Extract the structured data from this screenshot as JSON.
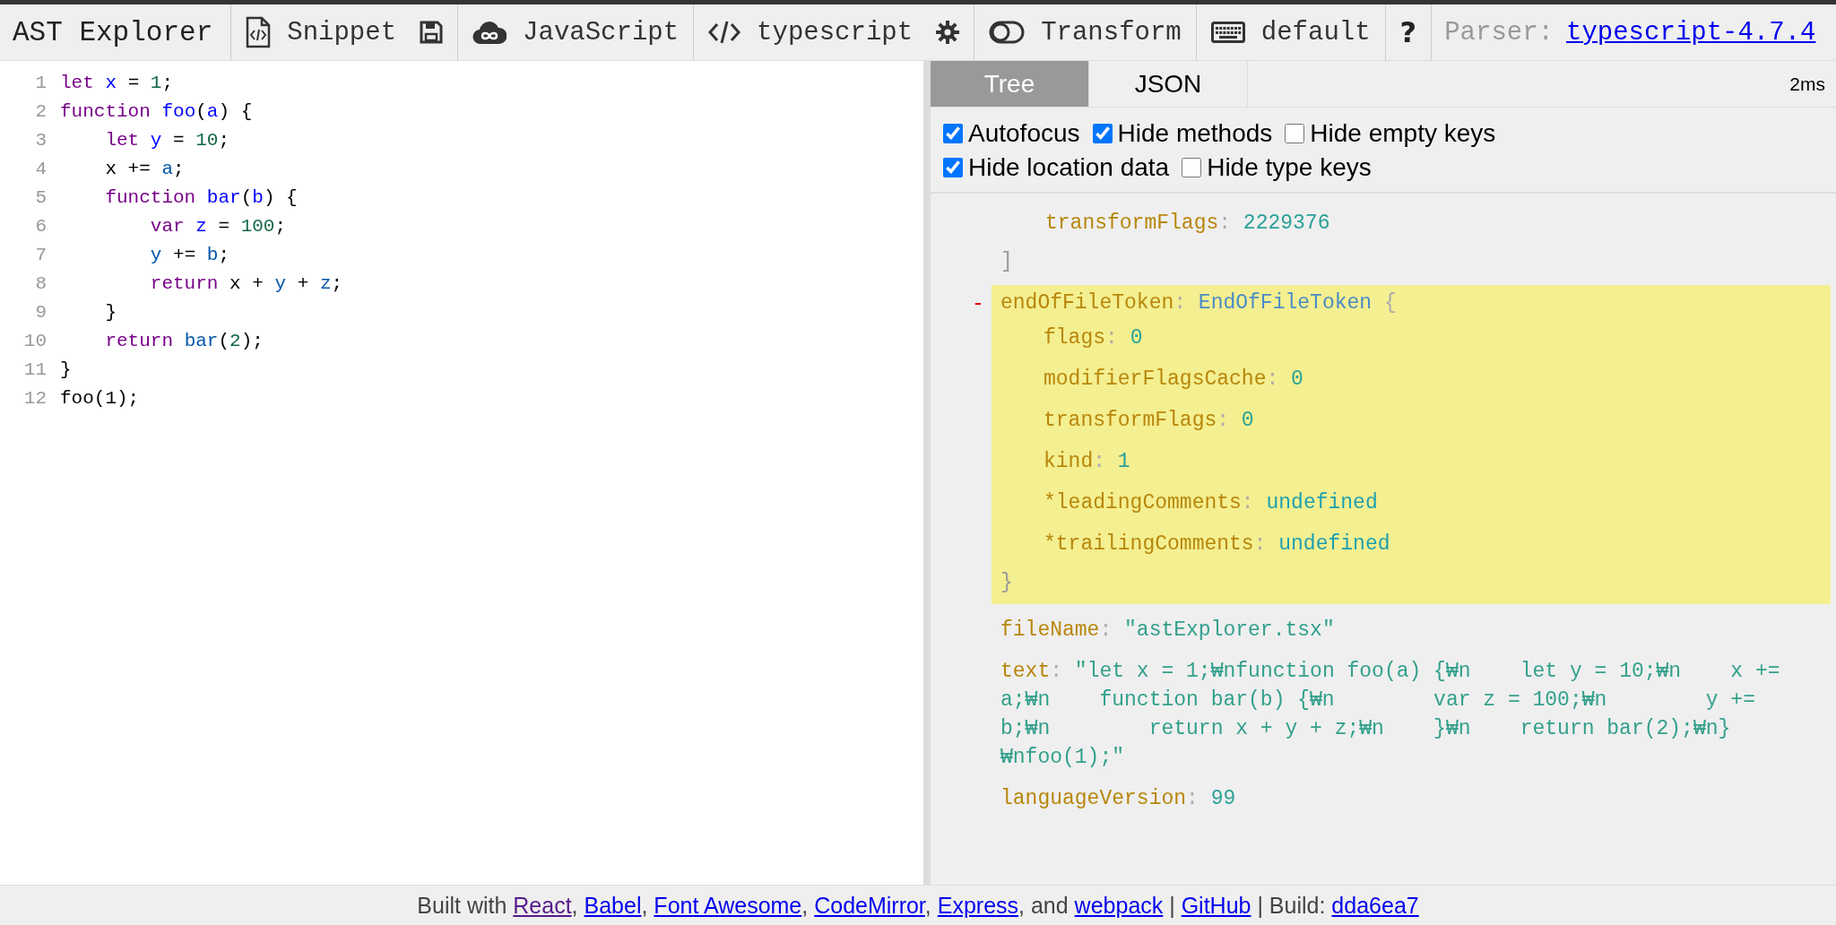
{
  "toolbar": {
    "title": "AST Explorer",
    "snippet": {
      "label": "Snippet"
    },
    "category": {
      "label": "JavaScript"
    },
    "parser": {
      "label": "typescript"
    },
    "transform": {
      "label": "Transform",
      "on": false
    },
    "keymap": {
      "label": "default"
    },
    "help": {
      "label": "?"
    },
    "parser_info": {
      "label": "Parser:",
      "link": "typescript-4.7.4"
    }
  },
  "editor": {
    "lines": [
      {
        "number": "1",
        "tokens": [
          {
            "t": "let",
            "kind": "keyword"
          },
          {
            "t": " x",
            "kind": "def"
          },
          {
            "t": " = ",
            "kind": "plain"
          },
          {
            "t": "1",
            "kind": "number"
          },
          {
            "t": ";",
            "kind": "plain"
          }
        ]
      },
      {
        "number": "2",
        "tokens": [
          {
            "t": "function",
            "kind": "keyword"
          },
          {
            "t": " foo",
            "kind": "def"
          },
          {
            "t": "(",
            "kind": "plain"
          },
          {
            "t": "a",
            "kind": "def"
          },
          {
            "t": ") {",
            "kind": "plain"
          }
        ]
      },
      {
        "number": "3",
        "tokens": [
          {
            "t": "    let",
            "kind": "keyword"
          },
          {
            "t": " y",
            "kind": "def"
          },
          {
            "t": " = ",
            "kind": "plain"
          },
          {
            "t": "10",
            "kind": "number"
          },
          {
            "t": ";",
            "kind": "plain"
          }
        ]
      },
      {
        "number": "4",
        "tokens": [
          {
            "t": "    x += ",
            "kind": "plain"
          },
          {
            "t": "a",
            "kind": "variable"
          },
          {
            "t": ";",
            "kind": "plain"
          }
        ]
      },
      {
        "number": "5",
        "tokens": [
          {
            "t": "    function",
            "kind": "keyword"
          },
          {
            "t": " bar",
            "kind": "def"
          },
          {
            "t": "(",
            "kind": "plain"
          },
          {
            "t": "b",
            "kind": "def"
          },
          {
            "t": ") {",
            "kind": "plain"
          }
        ]
      },
      {
        "number": "6",
        "tokens": [
          {
            "t": "        var",
            "kind": "keyword"
          },
          {
            "t": " z",
            "kind": "def"
          },
          {
            "t": " = ",
            "kind": "plain"
          },
          {
            "t": "100",
            "kind": "number"
          },
          {
            "t": ";",
            "kind": "plain"
          }
        ]
      },
      {
        "number": "7",
        "tokens": [
          {
            "t": "        y",
            "kind": "variable"
          },
          {
            "t": " += ",
            "kind": "plain"
          },
          {
            "t": "b",
            "kind": "variable"
          },
          {
            "t": ";",
            "kind": "plain"
          }
        ]
      },
      {
        "number": "8",
        "tokens": [
          {
            "t": "        return",
            "kind": "keyword"
          },
          {
            "t": " x + ",
            "kind": "plain"
          },
          {
            "t": "y",
            "kind": "variable"
          },
          {
            "t": " + ",
            "kind": "plain"
          },
          {
            "t": "z",
            "kind": "variable"
          },
          {
            "t": ";",
            "kind": "plain"
          }
        ]
      },
      {
        "number": "9",
        "tokens": [
          {
            "t": "    }",
            "kind": "plain"
          }
        ]
      },
      {
        "number": "10",
        "tokens": [
          {
            "t": "    return",
            "kind": "keyword"
          },
          {
            "t": " bar",
            "kind": "variable"
          },
          {
            "t": "(",
            "kind": "plain"
          },
          {
            "t": "2",
            "kind": "number"
          },
          {
            "t": ");",
            "kind": "plain"
          }
        ]
      },
      {
        "number": "11",
        "tokens": [
          {
            "t": "}",
            "kind": "plain"
          }
        ]
      },
      {
        "number": "12",
        "tokens": [
          {
            "t": "foo(1);",
            "kind": "plain"
          }
        ]
      }
    ]
  },
  "output": {
    "tabs": [
      {
        "label": "Tree",
        "selected": true
      },
      {
        "label": "JSON",
        "selected": false
      }
    ],
    "time": "2ms",
    "options": [
      {
        "label": "Autofocus",
        "checked": true
      },
      {
        "label": "Hide methods",
        "checked": true
      },
      {
        "label": "Hide empty keys",
        "checked": false
      },
      {
        "label": "Hide location data",
        "checked": true
      },
      {
        "label": "Hide type keys",
        "checked": false
      }
    ],
    "tree": [
      {
        "kind": "tail",
        "highlighted": false,
        "children": [
          {
            "key": "transformFlags",
            "separator": ":",
            "value": "2229376",
            "kind": "number"
          }
        ],
        "close": "]"
      },
      {
        "kind": "node",
        "highlighted": true,
        "toggle": "-",
        "key": "endOfFileToken",
        "separator": ":",
        "type_name": "EndOfFileToken",
        "open": "{",
        "close": "}",
        "children": [
          {
            "key": "flags",
            "separator": ":",
            "value": "0",
            "kind": "number"
          },
          {
            "key": "modifierFlagsCache",
            "separator": ":",
            "value": "0",
            "kind": "number"
          },
          {
            "key": "transformFlags",
            "separator": ":",
            "value": "0",
            "kind": "number"
          },
          {
            "key": "kind",
            "separator": ":",
            "value": "1",
            "kind": "number"
          },
          {
            "key": "*leadingComments",
            "separator": ":",
            "value": "undefined",
            "kind": "literal"
          },
          {
            "key": "*trailingComments",
            "separator": ":",
            "value": "undefined",
            "kind": "literal"
          }
        ]
      },
      {
        "kind": "string",
        "highlighted": false,
        "key": "fileName",
        "separator": ":",
        "value": "\"astExplorer.tsx\""
      },
      {
        "kind": "string",
        "highlighted": false,
        "key": "text",
        "separator": ":",
        "value": "\"let x = 1;₩nfunction foo(a) {₩n    let y = 10;₩n    x += a;₩n    function bar(b) {₩n        var z = 100;₩n        y += b;₩n        return x + y + z;₩n    }₩n    return bar(2);₩n}₩nfoo(1);\""
      },
      {
        "kind": "number",
        "highlighted": false,
        "key": "languageVersion",
        "separator": ":",
        "value": "99"
      }
    ]
  },
  "footer": {
    "parts": [
      {
        "text": "Built with ",
        "kind": "text"
      },
      {
        "text": "React",
        "kind": "link",
        "visited": true
      },
      {
        "text": ", ",
        "kind": "text"
      },
      {
        "text": "Babel",
        "kind": "link",
        "visited": false
      },
      {
        "text": ", ",
        "kind": "text"
      },
      {
        "text": "Font Awesome",
        "kind": "link",
        "visited": false
      },
      {
        "text": ", ",
        "kind": "text"
      },
      {
        "text": "CodeMirror",
        "kind": "link",
        "visited": false
      },
      {
        "text": ", ",
        "kind": "text"
      },
      {
        "text": "Express",
        "kind": "link",
        "visited": false
      },
      {
        "text": ", and ",
        "kind": "text"
      },
      {
        "text": "webpack",
        "kind": "link",
        "visited": false
      },
      {
        "text": " | ",
        "kind": "text"
      },
      {
        "text": "GitHub",
        "kind": "link",
        "visited": false
      },
      {
        "text": " | Build: ",
        "kind": "text"
      },
      {
        "text": "dda6ea7",
        "kind": "link",
        "visited": false
      }
    ]
  }
}
